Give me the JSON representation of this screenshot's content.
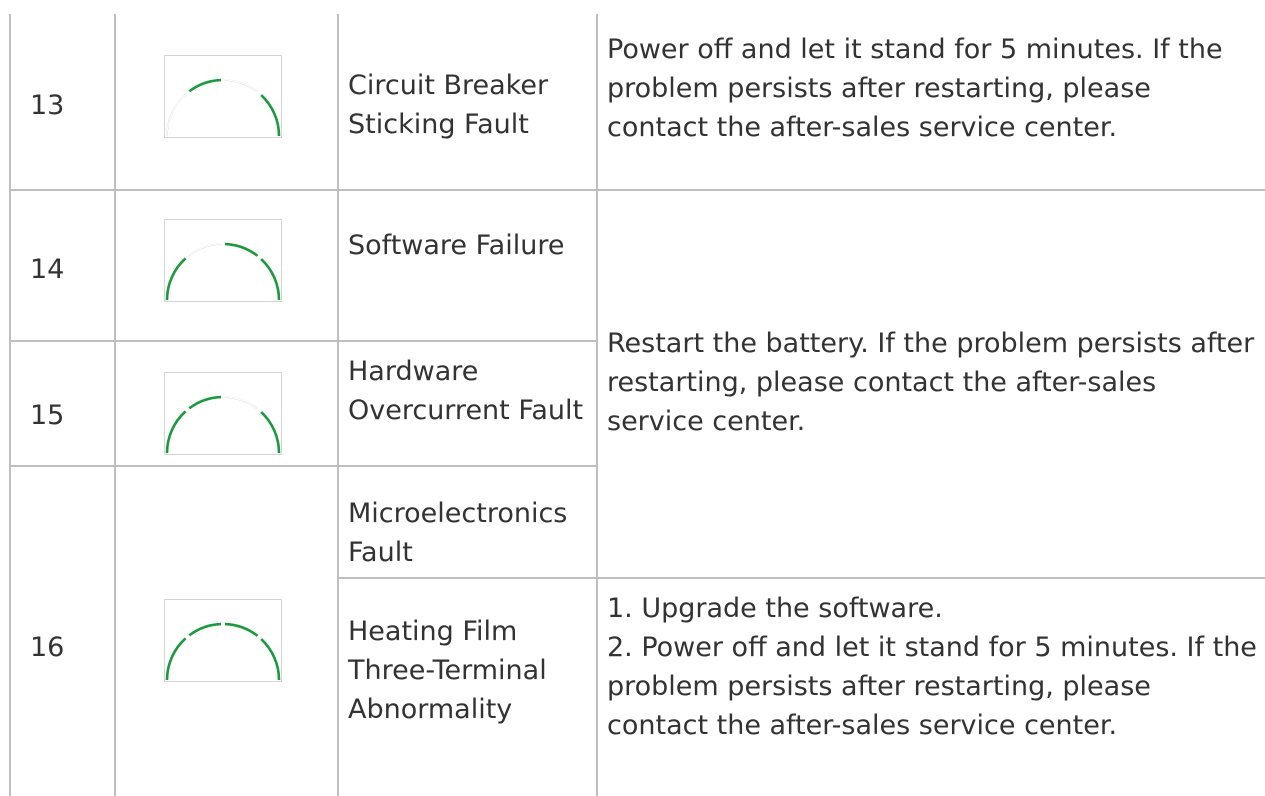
{
  "rows": [
    {
      "number": "13",
      "fault": "Circuit Breaker Sticking Fault",
      "indicator": [
        "off",
        "on",
        "off",
        "on"
      ]
    },
    {
      "number": "14",
      "fault": "Software Failure",
      "indicator": [
        "on",
        "off",
        "on",
        "on"
      ]
    },
    {
      "number": "15",
      "fault": "Hardware Overcurrent Fault",
      "indicator": [
        "on",
        "on",
        "off",
        "on"
      ]
    },
    {
      "number": "16",
      "faults": [
        "Microelectronics Fault",
        "Heating Film Three-Terminal Abnormality"
      ],
      "indicator": [
        "on",
        "on",
        "on",
        "on"
      ]
    }
  ],
  "solutions": {
    "row13": "Power off and let it stand for 5 minutes. If the problem persists after restarting, please contact the after-sales service center.",
    "rows14_16a": "Restart the battery. If the problem persists after restarting, please contact the after-sales service center.",
    "row16b": "1. Upgrade the software.\n2. Power off and let it stand for 5 minutes. If the problem persists after restarting, please contact the after-sales service center."
  },
  "colors": {
    "indicator_on": "#1a9a3c",
    "indicator_off": "#9e9e9e",
    "grid": "#bfbfbf",
    "text": "#333333"
  }
}
